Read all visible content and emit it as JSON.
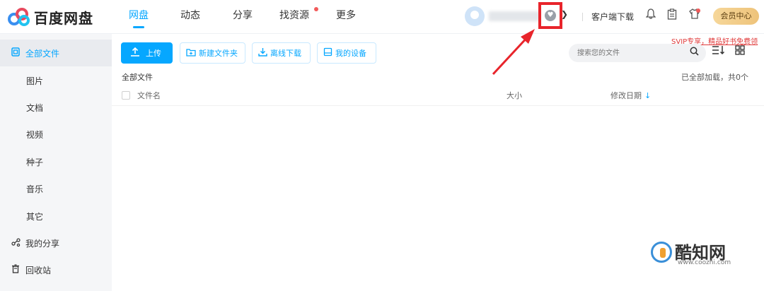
{
  "app": {
    "brand": "百度网盘"
  },
  "nav": [
    {
      "label": "网盘",
      "active": true
    },
    {
      "label": "动态",
      "active": false
    },
    {
      "label": "分享",
      "active": false
    },
    {
      "label": "找资源",
      "active": false,
      "dot": true
    },
    {
      "label": "更多",
      "active": false
    }
  ],
  "header": {
    "client_download": "客户端下载",
    "vip_center": "会员中心",
    "svip_note": "SVIP专享，精品好书免费领",
    "icons": [
      "bell-icon",
      "clipboard-icon",
      "shirt-icon"
    ]
  },
  "sidebar": {
    "items": [
      {
        "label": "全部文件",
        "icon": "files-icon",
        "active": true
      },
      {
        "label": "图片"
      },
      {
        "label": "文档"
      },
      {
        "label": "视频"
      },
      {
        "label": "种子"
      },
      {
        "label": "音乐"
      },
      {
        "label": "其它"
      },
      {
        "label": "我的分享",
        "icon": "share-icon"
      },
      {
        "label": "回收站",
        "icon": "trash-icon"
      }
    ]
  },
  "toolbar": {
    "upload": "上传",
    "new_folder": "新建文件夹",
    "offline_download": "离线下载",
    "my_devices": "我的设备"
  },
  "search": {
    "placeholder": "搜索您的文件"
  },
  "breadcrumb": "全部文件",
  "loaded_status": "已全部加载，共0个",
  "table": {
    "columns": {
      "name": "文件名",
      "size": "大小",
      "modified": "修改日期"
    }
  },
  "watermark": {
    "text": "酷知网",
    "url": "www.coozhi.com"
  },
  "colors": {
    "accent": "#06a7ff",
    "highlight": "#e8242b"
  }
}
